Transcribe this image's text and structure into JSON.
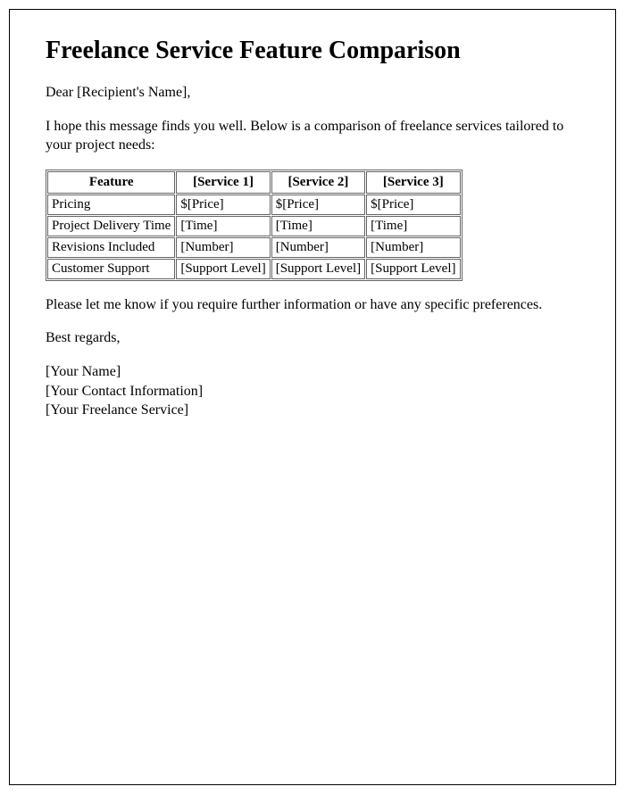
{
  "title": "Freelance Service Feature Comparison",
  "greeting": "Dear [Recipient's Name],",
  "intro": "I hope this message finds you well. Below is a comparison of freelance services tailored to your project needs:",
  "table": {
    "headers": [
      "Feature",
      "[Service 1]",
      "[Service 2]",
      "[Service 3]"
    ],
    "rows": [
      [
        "Pricing",
        "$[Price]",
        "$[Price]",
        "$[Price]"
      ],
      [
        "Project Delivery Time",
        "[Time]",
        "[Time]",
        "[Time]"
      ],
      [
        "Revisions Included",
        "[Number]",
        "[Number]",
        "[Number]"
      ],
      [
        "Customer Support",
        "[Support Level]",
        "[Support Level]",
        "[Support Level]"
      ]
    ]
  },
  "outro": "Please let me know if you require further information or have any specific preferences.",
  "closing": "Best regards,",
  "signature": {
    "name": "[Your Name]",
    "contact": "[Your Contact Information]",
    "service": "[Your Freelance Service]"
  }
}
